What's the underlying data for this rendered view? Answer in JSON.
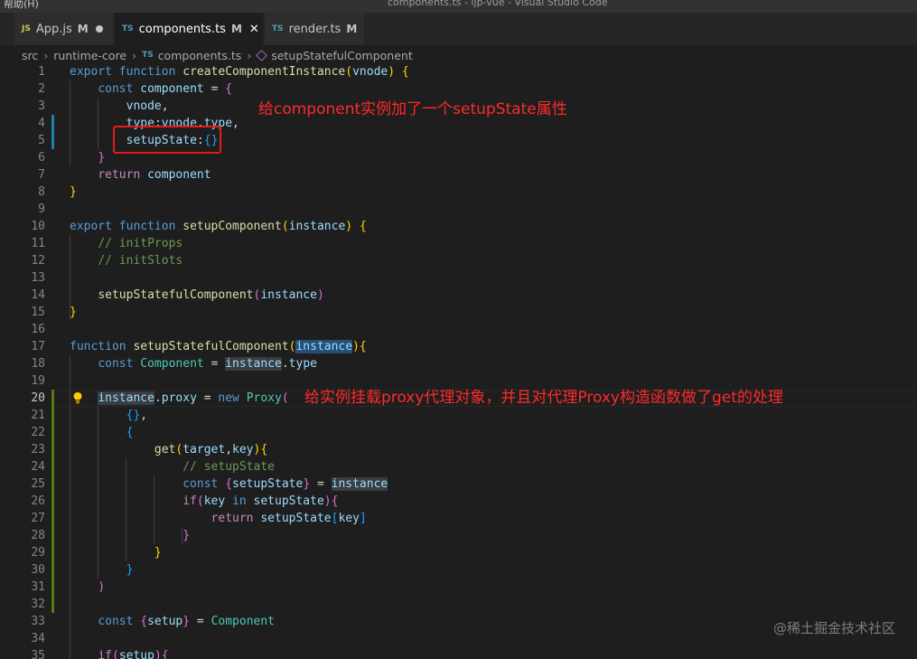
{
  "window": {
    "menu_label": "帮助(H)",
    "title": "components.ts - ljp-vue - Visual Studio Code"
  },
  "tabs": [
    {
      "label": "App.js",
      "badge": "M",
      "file_type": "JS",
      "state": "unsaved-dot"
    },
    {
      "label": "components.ts",
      "badge": "M",
      "file_type": "TS",
      "state": "active-close"
    },
    {
      "label": "render.ts",
      "badge": "M",
      "file_type": "TS",
      "state": "inactive"
    }
  ],
  "close_glyph": "✕",
  "breadcrumb": {
    "items": [
      "src",
      "runtime-core",
      "components.ts",
      "setupStatefulComponent"
    ],
    "file_type": "TS"
  },
  "line_numbers": [
    "1",
    "2",
    "3",
    "4",
    "5",
    "6",
    "7",
    "8",
    "9",
    "10",
    "11",
    "12",
    "13",
    "14",
    "15",
    "16",
    "17",
    "18",
    "19",
    "20",
    "21",
    "22",
    "23",
    "24",
    "25",
    "26",
    "27",
    "28",
    "29",
    "30",
    "31",
    "32",
    "33",
    "34",
    "35"
  ],
  "code_lines": [
    "export function createComponentInstance(vnode) {",
    "    const component = {",
    "        vnode,",
    "        type:vnode.type,",
    "        setupState:{}",
    "    }",
    "    return component",
    "}",
    "",
    "export function setupComponent(instance) {",
    "    // initProps",
    "    // initSlots",
    "",
    "    setupStatefulComponent(instance)",
    "}",
    "",
    "function setupStatefulComponent(instance){",
    "    const Component = instance.type",
    "",
    "    instance.proxy = new Proxy(",
    "        {},",
    "        {",
    "            get(target,key){",
    "                // setupState",
    "                const {setupState} = instance",
    "                if(key in setupState){",
    "                    return setupState[key]",
    "                }",
    "            }",
    "        }",
    "    )",
    "",
    "    const {setup} = Component",
    "",
    "    if(setup){"
  ],
  "annotations": {
    "note_setup_state": "给component实例加了一个setupState属性",
    "note_proxy": "给实例挂载proxy代理对象，并且对代理Proxy构造函数做了get的处理"
  },
  "watermark": "@稀土掘金技术社区",
  "colors": {
    "keyword": "#569cd6",
    "function": "#dcdcaa",
    "variable": "#9cdcfe",
    "class": "#4ec9b0",
    "comment": "#6a9955",
    "annotation": "#ff2a2a"
  }
}
